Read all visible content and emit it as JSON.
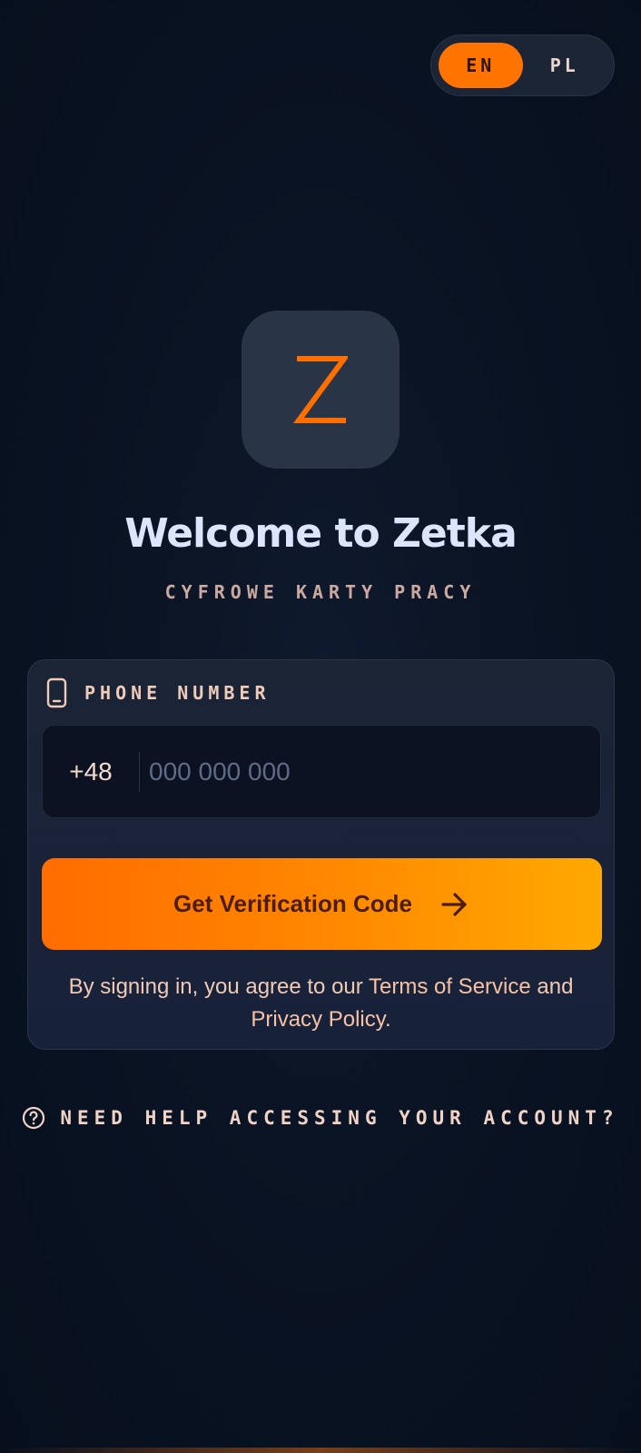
{
  "language_toggle": {
    "active": "EN",
    "options": [
      "EN",
      "PL"
    ]
  },
  "brand": {
    "logo_letter": "Z",
    "title": "Welcome to Zetka",
    "subtitle": "CYFROWE KARTY PRACY"
  },
  "login_card": {
    "phone_label": "PHONE NUMBER",
    "country_code": "+48",
    "phone_placeholder": "000 000 000",
    "phone_value": "",
    "submit_label": "Get Verification Code",
    "terms_prefix": "By signing in, you agree to our ",
    "terms_link": "Terms of Service",
    "terms_and": " and ",
    "privacy_link": "Privacy Policy",
    "terms_suffix": "."
  },
  "help": {
    "label": "NEED HELP ACCESSING YOUR ACCOUNT?"
  },
  "colors": {
    "accent": "#ff7300",
    "accent_gradient_end": "#ffa900",
    "background": "#081120",
    "card": "#1b2435"
  },
  "icons": {
    "phone_label": "smartphone-icon",
    "submit": "arrow-right-icon",
    "help": "help-circle-icon"
  }
}
